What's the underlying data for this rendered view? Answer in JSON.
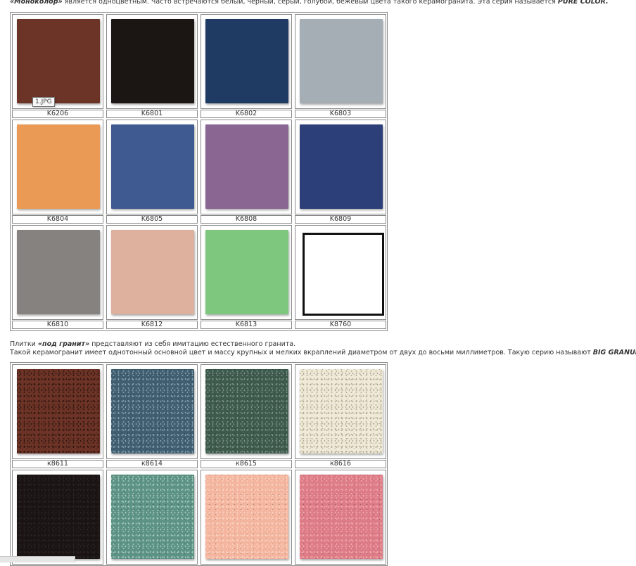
{
  "intro": {
    "lead_bold": "«Моноколор»",
    "text": " является одноцветным. Часто встречаются белый, чёрный, серый, голубой, бежевый цвета такого керамогранита. Эта серия называется ",
    "series_bold": "PURE COLOR."
  },
  "pure_color": {
    "tooltip": "1.JPG",
    "rows": [
      [
        {
          "code": "K6206",
          "color": "#6b3427"
        },
        {
          "code": "K6801",
          "color": "#1b1614"
        },
        {
          "code": "K6802",
          "color": "#1f3a63"
        },
        {
          "code": "K6803",
          "color": "#a5adb5"
        }
      ],
      [
        {
          "code": "K6804",
          "color": "#ea9a55"
        },
        {
          "code": "K6805",
          "color": "#3f5a91"
        },
        {
          "code": "K6808",
          "color": "#8a6792"
        },
        {
          "code": "K6809",
          "color": "#2c3f78"
        }
      ],
      [
        {
          "code": "K6810",
          "color": "#858280"
        },
        {
          "code": "K6812",
          "color": "#deb09e"
        },
        {
          "code": "K6813",
          "color": "#7ec77f"
        },
        {
          "code": "K8760",
          "color": "#ffffff"
        }
      ]
    ]
  },
  "granite": {
    "line1_pre": "Плитки ",
    "line1_bold": "«под гранит»",
    "line1_post": " представляют из себя имитацию естественного гранита.",
    "line2_text": "Такой керамогранит имеет однотонный основной цвет и массу крупных и мелких вкраплений диаметром от двух до восьми миллиметров. Такую серию называют ",
    "line2_bold": "BIG GRANULAR.",
    "rows": [
      [
        {
          "code": "к8611",
          "color": "#6c3326",
          "speck": "#2a1510"
        },
        {
          "code": "к8614",
          "color": "#3f5e70",
          "speck": "#8aa3b2"
        },
        {
          "code": "к8615",
          "color": "#3e5a4c",
          "speck": "#7e968a"
        },
        {
          "code": "к8616",
          "color": "#efe9d8",
          "speck": "#b3aa8e"
        }
      ],
      [
        {
          "code": "",
          "color": "#1a1414",
          "speck": "#2e2626"
        },
        {
          "code": "",
          "color": "#5d9384",
          "speck": "#a7cbbf"
        },
        {
          "code": "",
          "color": "#f4b59e",
          "speck": "#fbd6c7"
        },
        {
          "code": "",
          "color": "#dd7c86",
          "speck": "#f2aab0"
        }
      ]
    ]
  }
}
